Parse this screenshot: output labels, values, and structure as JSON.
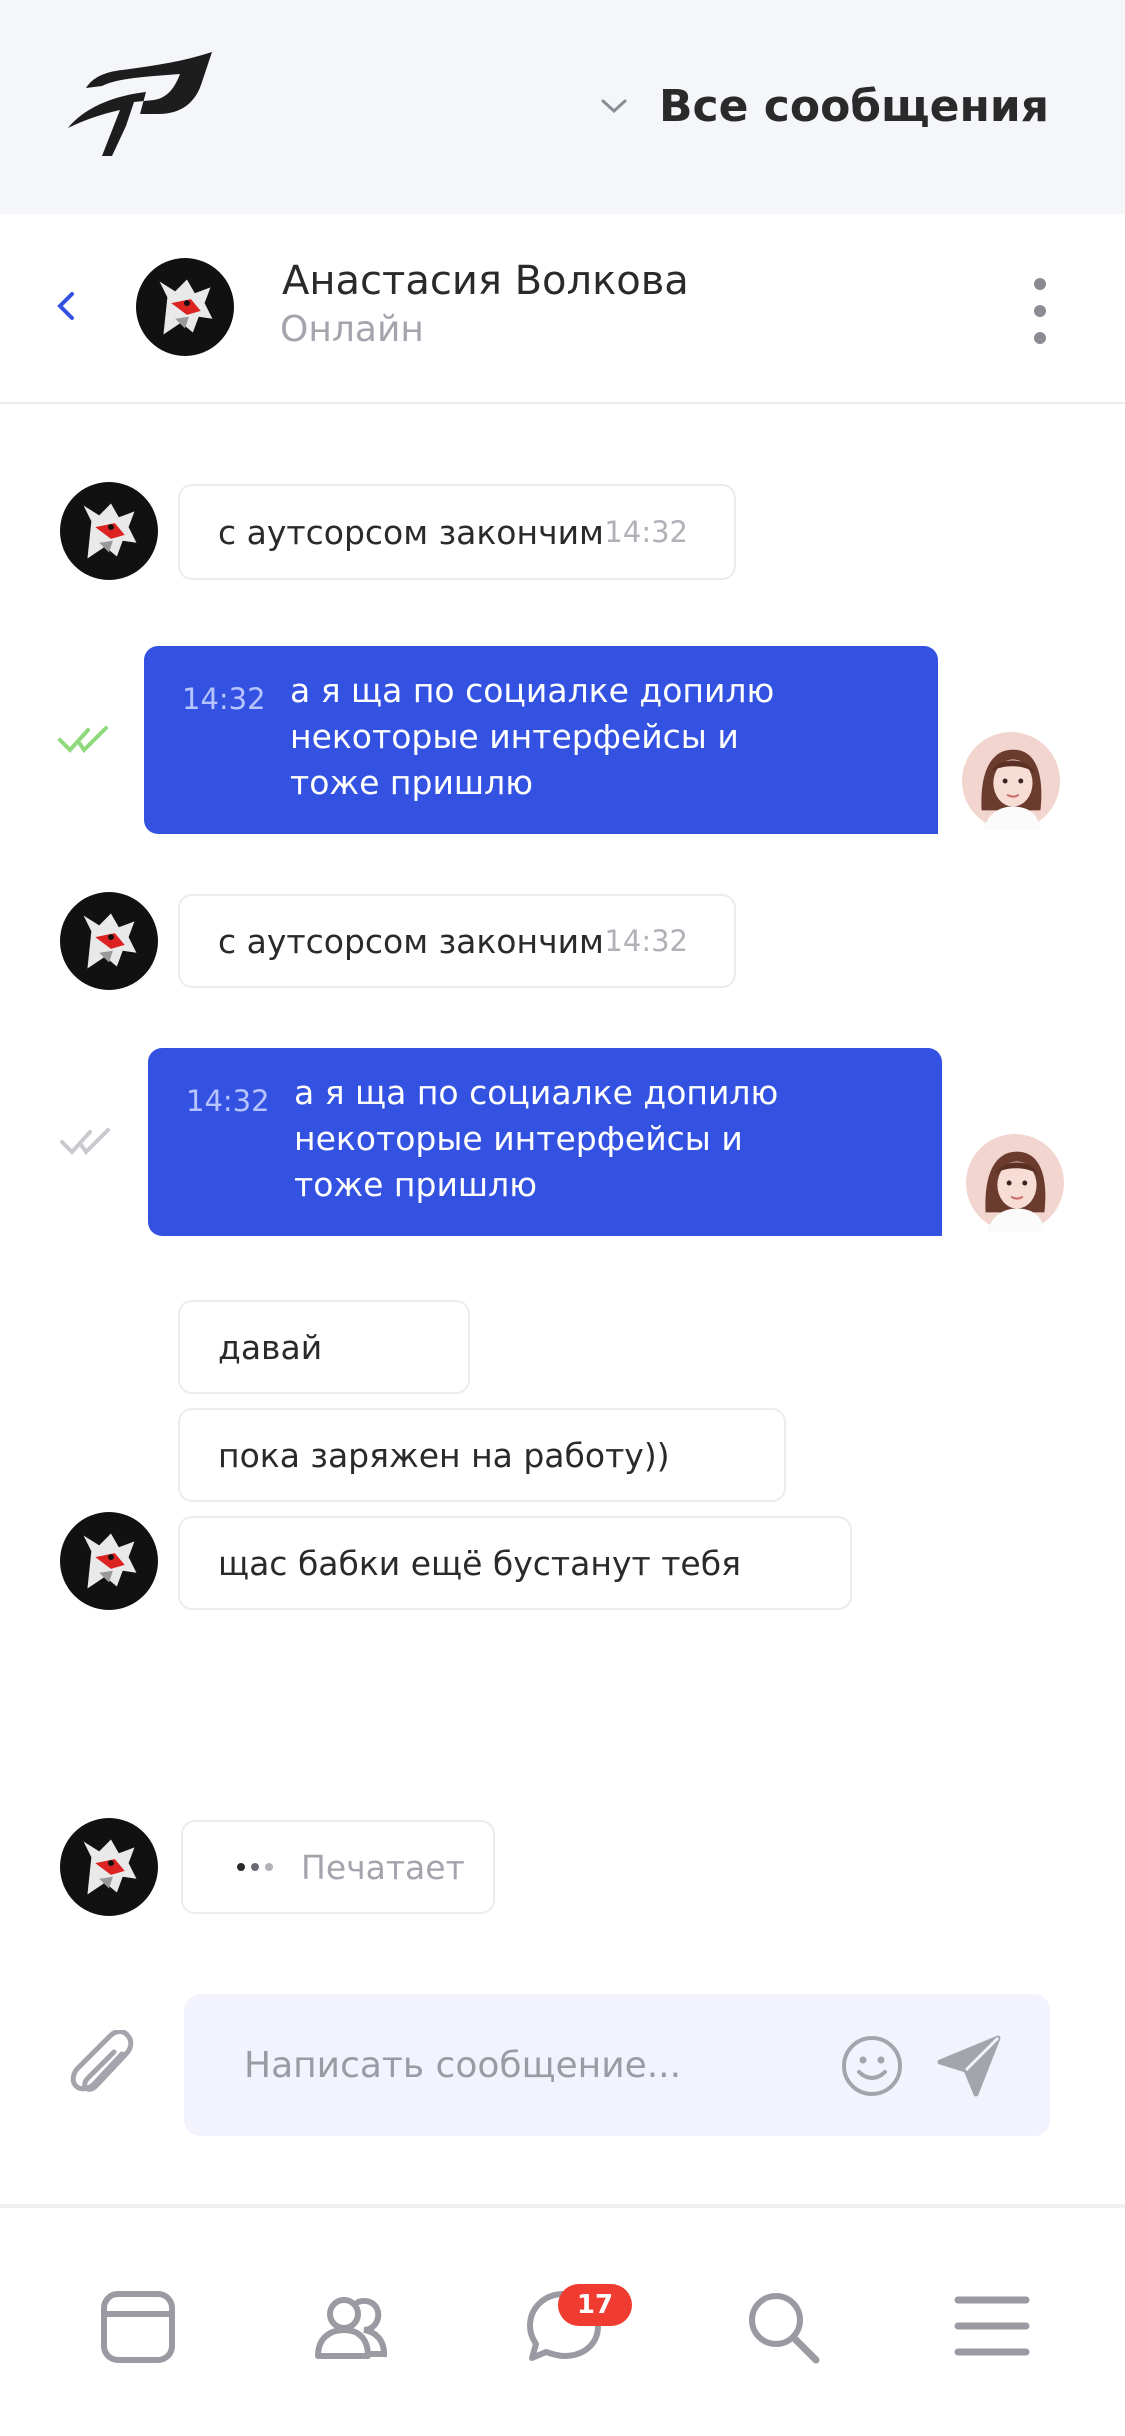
{
  "header": {
    "filter_label": "Все сообщения",
    "filter_icon": "chevron-down-icon",
    "logo_icon": "brand-logo"
  },
  "chat": {
    "contact_name": "Анастасия Волкова",
    "contact_status": "Онлайн",
    "back_icon": "chevron-left-icon",
    "menu_icon": "more-vertical-icon"
  },
  "messages": [
    {
      "direction": "in",
      "text": "с аутсорсом закончим",
      "time": "14:32"
    },
    {
      "direction": "out",
      "text": "а я ща по социалке допилю некоторые интерфейсы и тоже пришлю",
      "time": "14:32",
      "read": true
    },
    {
      "direction": "in",
      "text": "с аутсорсом закончим",
      "time": "14:32"
    },
    {
      "direction": "out",
      "text": "а я ща по социалке допилю некоторые интерфейсы и тоже пришлю",
      "time": "14:32",
      "read": false
    },
    {
      "direction": "in",
      "text": "давай"
    },
    {
      "direction": "in",
      "text": "пока заряжен на работу))"
    },
    {
      "direction": "in",
      "text": "щас бабки ещё бустанут тебя"
    }
  ],
  "typing": {
    "label": "Печатает"
  },
  "composer": {
    "placeholder": "Написать сообщение...",
    "attach_icon": "paperclip-icon",
    "emoji_icon": "smiley-icon",
    "send_icon": "send-icon"
  },
  "tabbar": {
    "items": [
      {
        "icon": "feed-icon"
      },
      {
        "icon": "friends-icon"
      },
      {
        "icon": "chat-icon",
        "badge": "17"
      },
      {
        "icon": "search-icon"
      },
      {
        "icon": "menu-icon"
      }
    ]
  },
  "colors": {
    "accent": "#3352e2",
    "read_check": "#8fd97a",
    "unread_check": "#c9c9cf",
    "badge": "#ef3b30",
    "topbar_bg": "#f5f6fa"
  }
}
